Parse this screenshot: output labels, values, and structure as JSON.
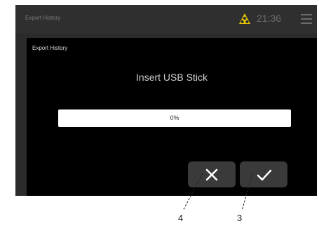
{
  "topbar": {
    "title": "Export History",
    "warning_icon": "warning-icon",
    "time": "21:36",
    "menu_icon": "hamburger-menu-icon"
  },
  "panel": {
    "title": "Export History",
    "message": "Insert USB Stick",
    "progress": {
      "value": 0,
      "label": "0%"
    }
  },
  "buttons": {
    "cancel_icon": "close-icon",
    "confirm_icon": "check-icon"
  },
  "callouts": {
    "cancel": "4",
    "confirm": "3"
  },
  "colors": {
    "background": "#000000",
    "topbar": "#2f2f2f",
    "warning": "#e6c800",
    "button": "#3a3a3a"
  }
}
